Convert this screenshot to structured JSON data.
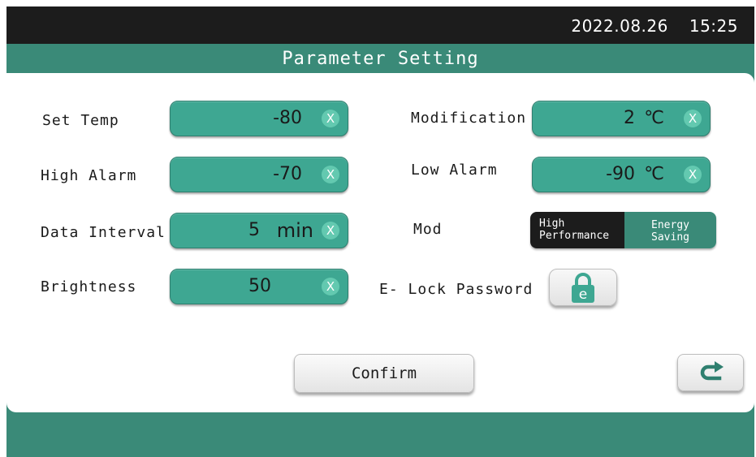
{
  "status_bar": {
    "date": "2022.08.26",
    "time": "15:25"
  },
  "header": {
    "title": "Parameter Setting"
  },
  "fields": {
    "set_temp": {
      "label": "Set Temp",
      "value": "-80",
      "clear": "X"
    },
    "high_alarm": {
      "label": "High Alarm",
      "value": "-70",
      "clear": "X"
    },
    "data_interval": {
      "label": "Data Interval",
      "value": "5",
      "unit": "min",
      "clear": "X"
    },
    "brightness": {
      "label": "Brightness",
      "value": "50",
      "clear": "X"
    },
    "modification": {
      "label": "Modification",
      "value": "2",
      "unit": "℃",
      "clear": "X"
    },
    "low_alarm": {
      "label": "Low Alarm",
      "value": "-90",
      "unit": "℃",
      "clear": "X"
    }
  },
  "mode": {
    "label": "Mod",
    "options": [
      {
        "line1": "High",
        "line2": "Performance",
        "selected": false
      },
      {
        "line1": "Energy",
        "line2": "Saving",
        "selected": true
      }
    ]
  },
  "elock": {
    "label": "E- Lock Password",
    "icon": "lock-icon",
    "icon_letter": "e"
  },
  "actions": {
    "confirm_label": "Confirm",
    "back_icon": "return-arrow-icon"
  },
  "colors": {
    "teal": "#3ea792",
    "dark_teal": "#3a8a78",
    "black_bar": "#1c1c1c"
  }
}
